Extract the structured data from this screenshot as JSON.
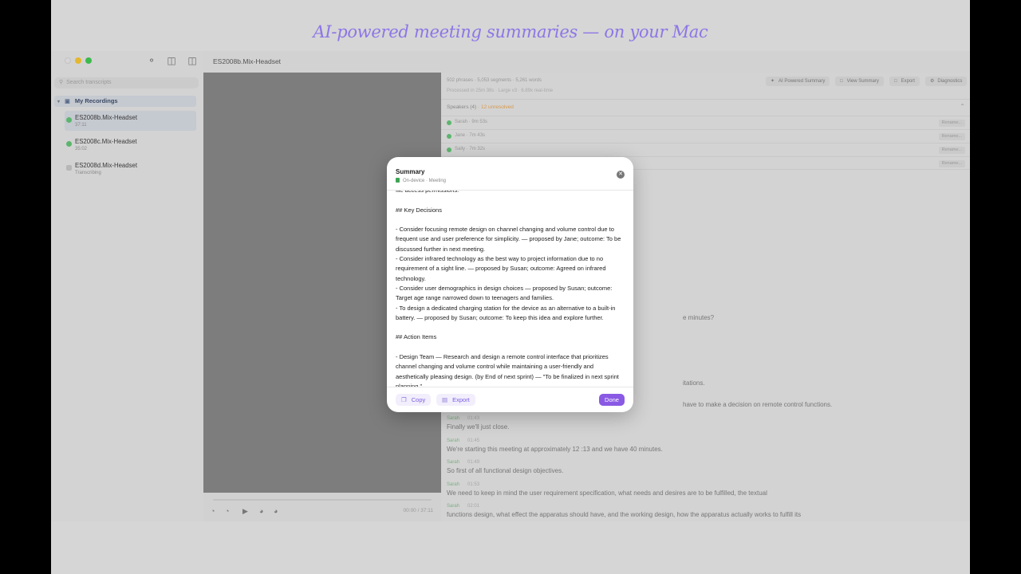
{
  "hero_tagline": "AI-powered meeting summaries — on your Mac",
  "sidebar": {
    "search_placeholder": "Search transcripts",
    "group_label": "My Recordings",
    "recordings": [
      {
        "name": "ES2008b.Mix-Headset",
        "sub": "37:11",
        "status": "done"
      },
      {
        "name": "ES2008c.Mix-Headset",
        "sub": "35:02",
        "status": "done"
      },
      {
        "name": "ES2008d.Mix-Headset",
        "sub": "Transcribing",
        "status": "pending"
      }
    ]
  },
  "window": {
    "title": "ES2008b.Mix-Headset"
  },
  "player": {
    "time": "00:00 / 37:11"
  },
  "panel": {
    "stats": "502 phrases · 5,053 segments · 5,261 words",
    "processed": "Processed in 25m 38s · Large v3 · 6.89x real-time",
    "toolbar": {
      "ai_summary": "AI Powered Summary",
      "view_summary": "View Summary",
      "export": "Export",
      "diagnostics": "Diagnostics"
    },
    "speakers_label": "Speakers (4)",
    "unresolved": "· 12 unresolved",
    "rename_label": "Rename...",
    "speakers": [
      {
        "name": "Sarah",
        "time": "9m 53s"
      },
      {
        "name": "Jane",
        "time": "7m 43s"
      },
      {
        "name": "Sally",
        "time": "7m 32s"
      }
    ],
    "fragments": {
      "f1": "e minutes?",
      "f2": "itations.",
      "f3": "have to make a decision on remote control functions."
    },
    "segments": [
      {
        "speaker": "Sarah",
        "time": "01:43",
        "text": "Finally we'll just close."
      },
      {
        "speaker": "Sarah",
        "time": "01:45",
        "text": "We're starting this meeting at approximately 12 :13 and we have 40 minutes."
      },
      {
        "speaker": "Sarah",
        "time": "01:49",
        "text": "So first of all functional design objectives."
      },
      {
        "speaker": "Sarah",
        "time": "01:53",
        "text": "We need to keep in mind the user requirement specification, what needs and desires are to be fulfilled, the textual"
      },
      {
        "speaker": "Sarah",
        "time": "02:01",
        "text": "functions design, what effect the apparatus should have, and the working design, how the apparatus actually works to fulfill its"
      }
    ]
  },
  "modal": {
    "title": "Summary",
    "subtitle": "On-device · Meeting",
    "body": "file access permissions.\n\n## Key Decisions\n\n- Consider focusing remote design on channel changing and volume control due to frequent use and user preference for simplicity. — proposed by Jane; outcome: To be discussed further in next meeting.\n- Consider infrared technology as the best way to project information due to no requirement of a sight line. — proposed by Susan; outcome: Agreed on infrared technology.\n- Consider user demographics in design choices — proposed by Susan; outcome: Target age range narrowed down to teenagers and families.\n- To design a dedicated charging station for the device as an alternative to a built-in battery. — proposed by Susan; outcome: To keep this idea and explore further.\n\n## Action Items\n\n- Design Team — Research and design a remote control interface that prioritizes channel changing and volume control while maintaining a user-friendly and aesthetically pleasing design. (by End of next sprint) — \"To be finalized in next sprint planning.\"",
    "copy_label": "Copy",
    "export_label": "Export",
    "done_label": "Done"
  }
}
